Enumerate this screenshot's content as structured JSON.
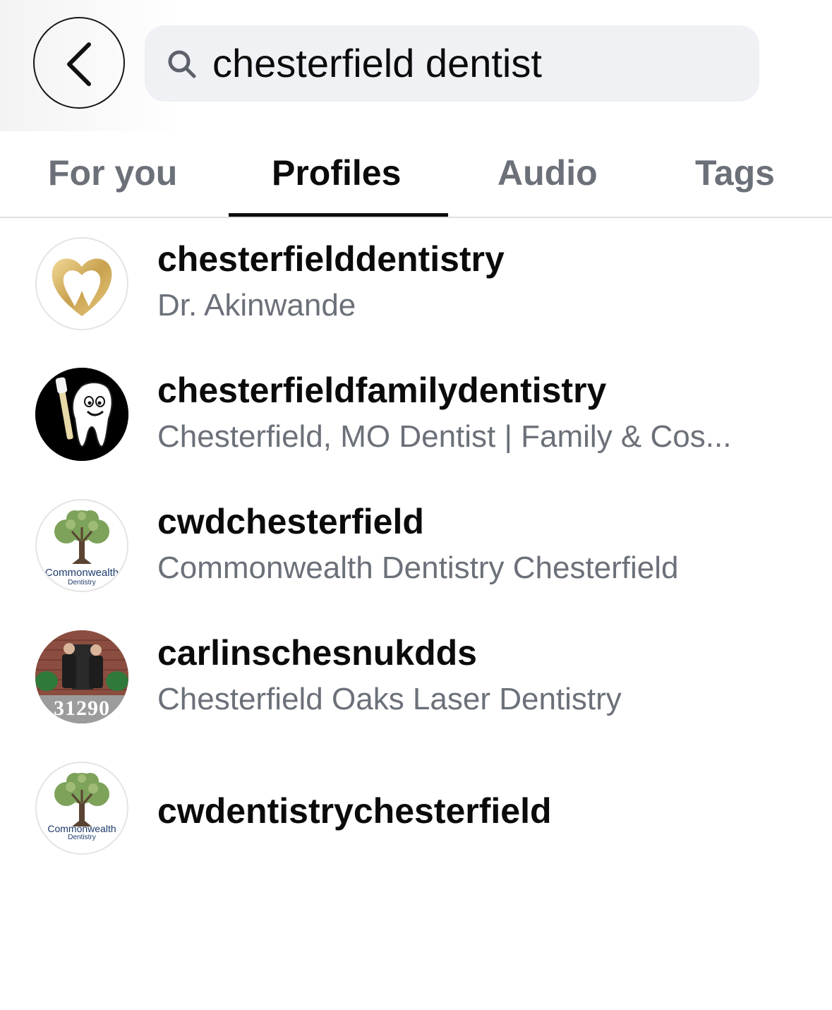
{
  "search": {
    "query": "chesterfield dentist"
  },
  "tabs": [
    {
      "label": "For you"
    },
    {
      "label": "Profiles"
    },
    {
      "label": "Audio"
    },
    {
      "label": "Tags"
    }
  ],
  "active_tab": "Profiles",
  "results": [
    {
      "username": "chesterfielddentistry",
      "full_name": "Dr. Akinwande",
      "avatar_icon": "gold-tooth-heart-logo-icon"
    },
    {
      "username": "chesterfieldfamilydentistry",
      "full_name": "Chesterfield, MO Dentist | Family & Cos...",
      "avatar_icon": "cartoon-tooth-mascot-icon"
    },
    {
      "username": "cwdchesterfield",
      "full_name": "Commonwealth Dentistry Chesterfield",
      "avatar_icon": "tree-logo-icon",
      "avatar_text": {
        "line1": "Commonwealth",
        "line2": "Dentistry"
      }
    },
    {
      "username": "carlinschesnukdds",
      "full_name": "Chesterfield Oaks Laser Dentistry",
      "avatar_icon": "office-photo-icon",
      "avatar_text": {
        "line1": "31290"
      }
    },
    {
      "username": "cwdentistrychesterfield",
      "full_name": "",
      "avatar_icon": "tree-logo-icon",
      "avatar_text": {
        "line1": "Commonwealth",
        "line2": "Dentistry"
      }
    }
  ],
  "colors": {
    "accent": "#0b0b0b",
    "secondary_text": "#6b7079",
    "search_bg": "#eff1f5",
    "gold": "#d4b060"
  }
}
